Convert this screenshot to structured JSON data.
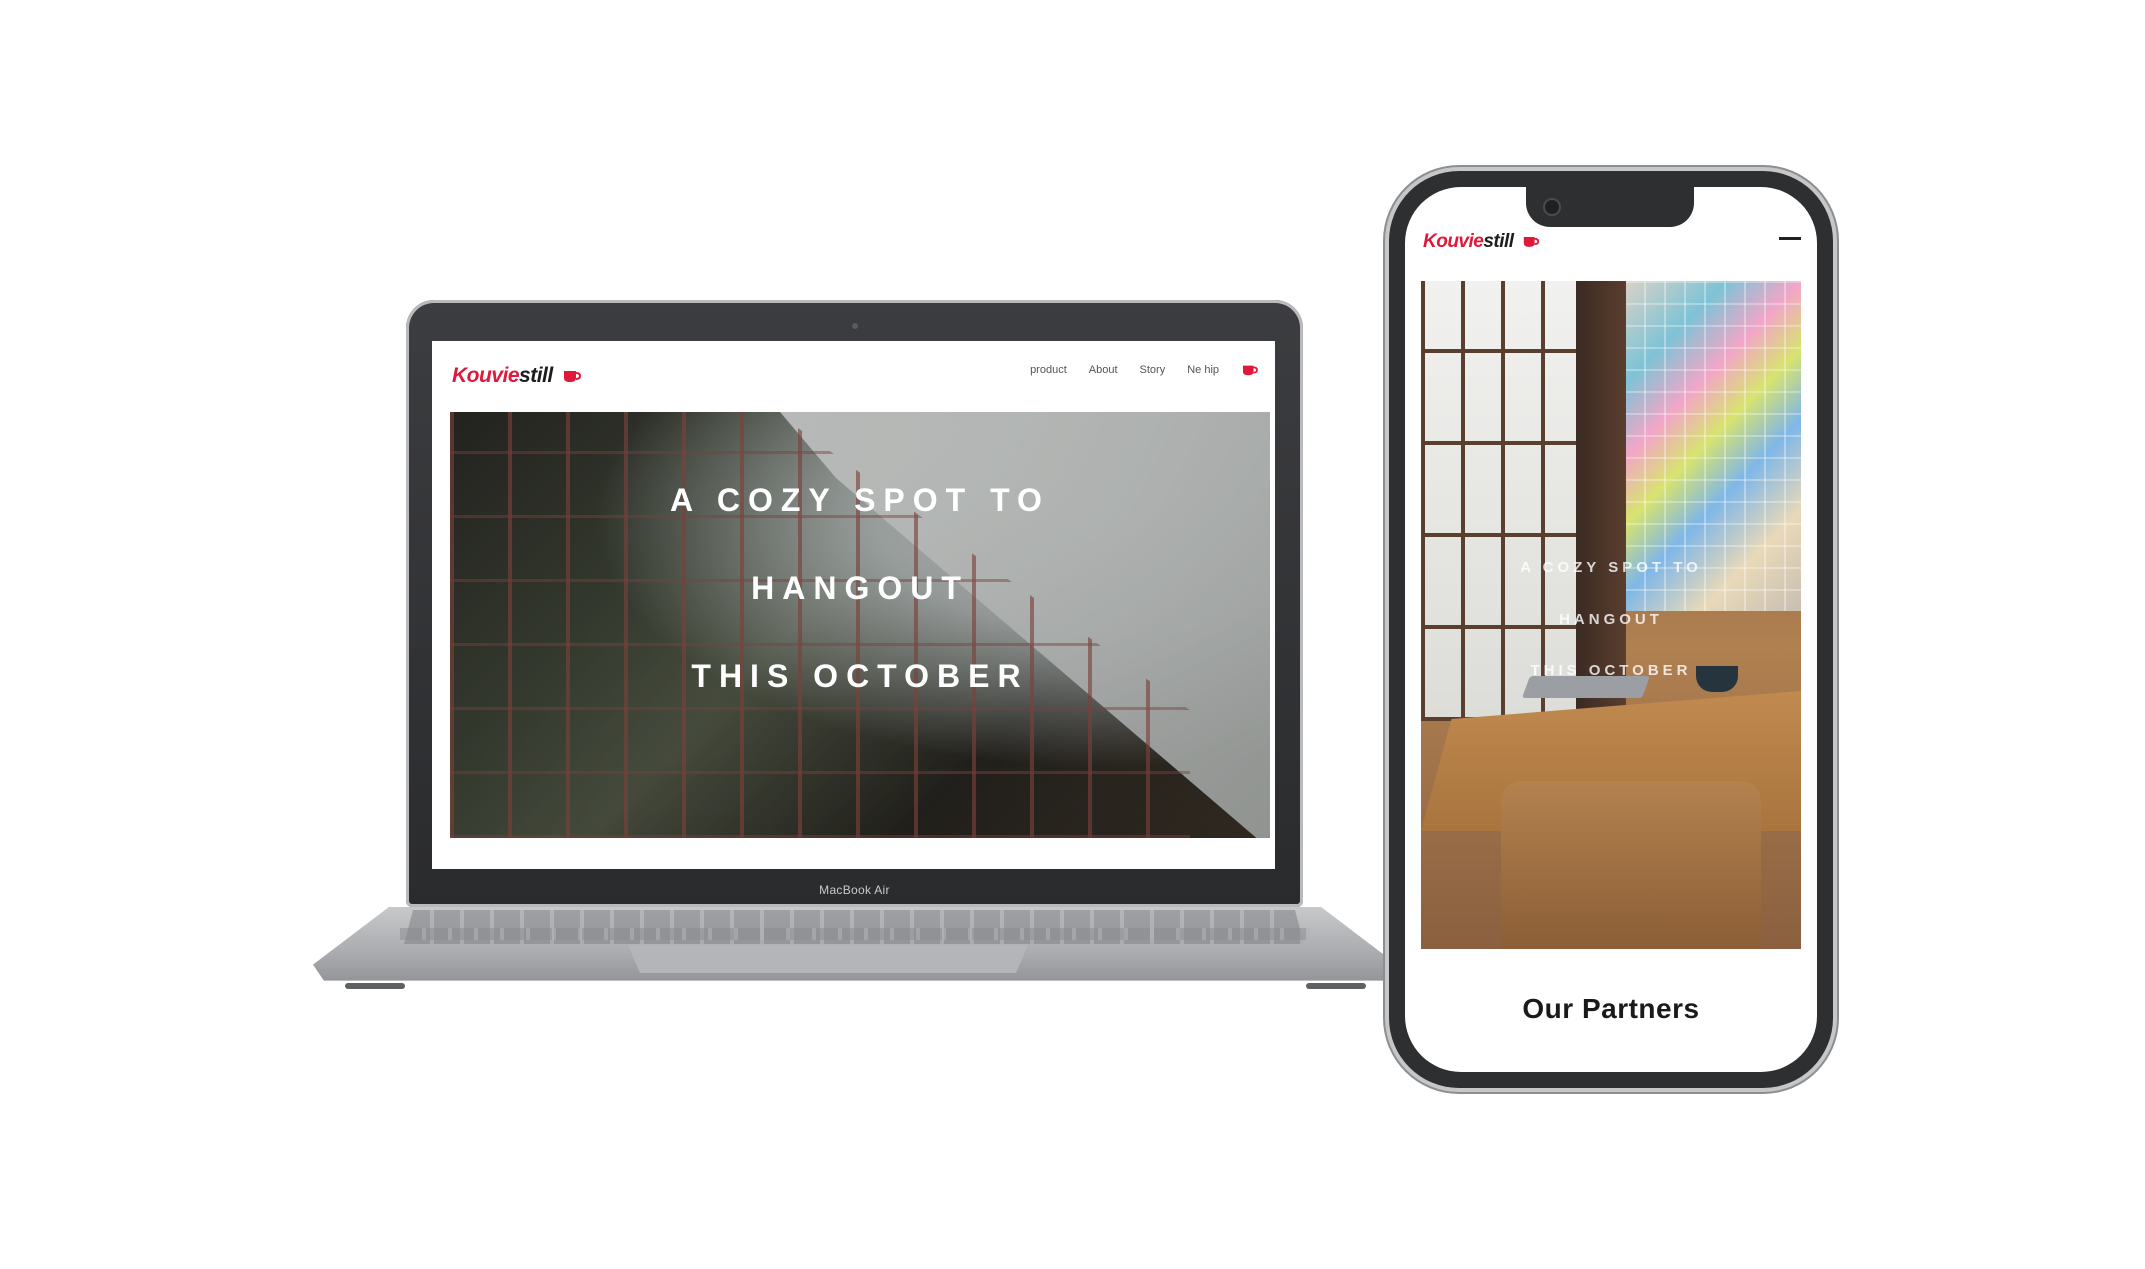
{
  "brand": {
    "name_part1": "Kouvie",
    "name_part2": "still",
    "accent_color": "#e0183a"
  },
  "laptop": {
    "model_label": "MacBook Air",
    "nav": {
      "items": [
        {
          "label": "product"
        },
        {
          "label": "About"
        },
        {
          "label": "Story"
        },
        {
          "label": "Ne hip"
        }
      ],
      "cart_icon": "coffee-cup-icon"
    },
    "hero": {
      "lines": [
        "A COZY SPOT TO",
        "HANGOUT",
        "THIS OCTOBER"
      ]
    }
  },
  "phone": {
    "menu_icon": "hamburger-menu-icon",
    "hero": {
      "lines": [
        "A COZY SPOT TO",
        "HANGOUT",
        "THIS OCTOBER"
      ]
    },
    "section_title": "Our Partners"
  }
}
